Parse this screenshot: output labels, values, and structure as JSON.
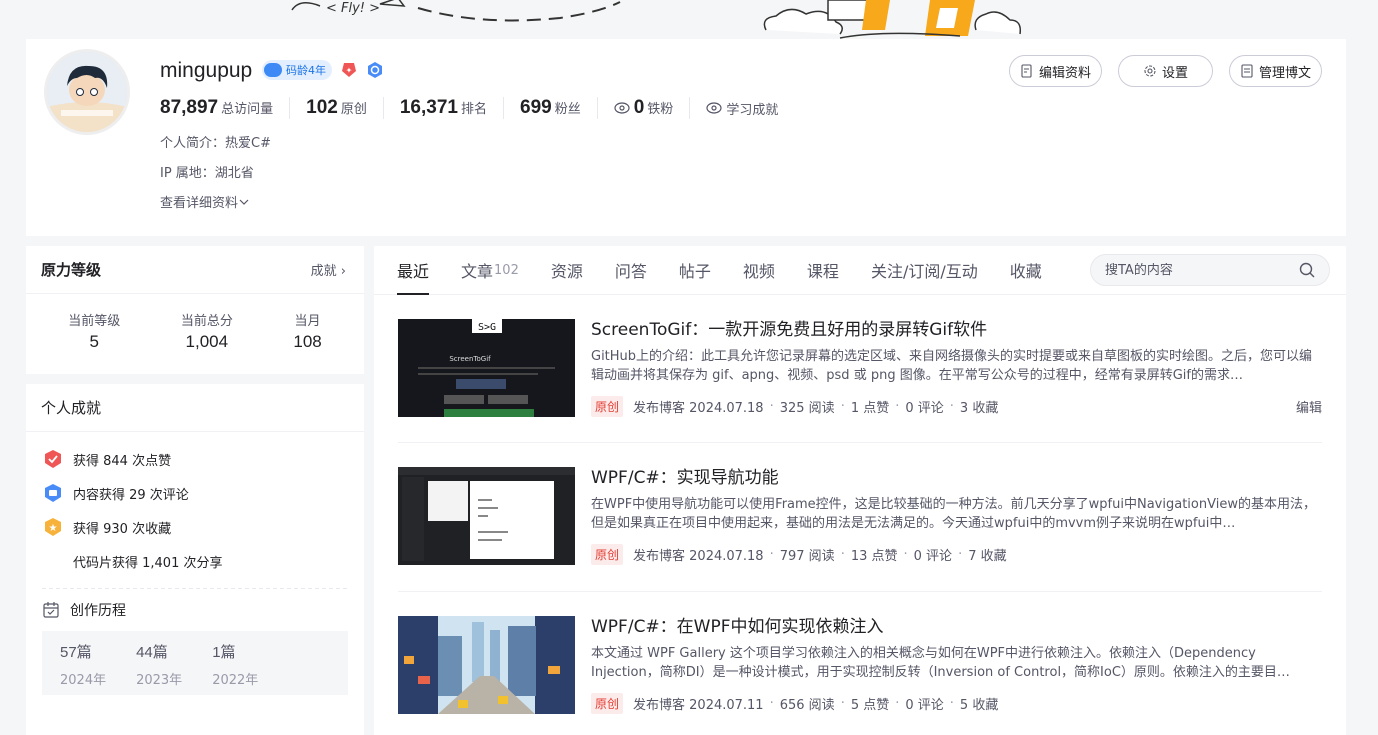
{
  "banner": {
    "fly_text": "< Fly! >"
  },
  "profile": {
    "username": "mingupup",
    "badge_age": "码龄4年",
    "stats": [
      {
        "value": "87,897",
        "label": "总访问量"
      },
      {
        "value": "102",
        "label": "原创"
      },
      {
        "value": "16,371",
        "label": "排名"
      },
      {
        "value": "699",
        "label": "粉丝"
      },
      {
        "value": "0",
        "label": "铁粉"
      }
    ],
    "learn_label": "学习成就",
    "bio": "个人简介：热爱C#",
    "ip": "IP 属地：湖北省",
    "more": "查看详细资料",
    "buttons": {
      "edit": "编辑资料",
      "settings": "设置",
      "manage": "管理博文"
    }
  },
  "level_card": {
    "title": "原力等级",
    "more": "成就",
    "items": [
      {
        "label": "当前等级",
        "value": "5"
      },
      {
        "label": "当前总分",
        "value": "1,004"
      },
      {
        "label": "当月",
        "value": "108"
      }
    ]
  },
  "achievements": {
    "title": "个人成就",
    "items": [
      {
        "text": "获得 844 次点赞",
        "icon": "like-medal-icon",
        "color": "#f05656"
      },
      {
        "text": "内容获得 29 次评论",
        "icon": "comment-medal-icon",
        "color": "#4a8cf7"
      },
      {
        "text": "获得 930 次收藏",
        "icon": "star-medal-icon",
        "color": "#f7b23b"
      },
      {
        "text": "代码片获得 1,401 次分享",
        "icon": "",
        "color": ""
      }
    ],
    "history_title": "创作历程",
    "history": [
      {
        "count": "57篇",
        "year": "2024年"
      },
      {
        "count": "44篇",
        "year": "2023年"
      },
      {
        "count": "1篇",
        "year": "2022年"
      }
    ]
  },
  "tabs": [
    {
      "label": "最近",
      "count": ""
    },
    {
      "label": "文章",
      "count": "102"
    },
    {
      "label": "资源",
      "count": ""
    },
    {
      "label": "问答",
      "count": ""
    },
    {
      "label": "帖子",
      "count": ""
    },
    {
      "label": "视频",
      "count": ""
    },
    {
      "label": "课程",
      "count": ""
    },
    {
      "label": "关注/订阅/互动",
      "count": ""
    },
    {
      "label": "收藏",
      "count": ""
    }
  ],
  "search": {
    "placeholder": "搜TA的内容"
  },
  "articles": [
    {
      "title": "ScreenToGif：一款开源免费且好用的录屏转Gif软件",
      "desc": "GitHub上的介绍：此工具允许您记录屏幕的选定区域、来自网络摄像头的实时提要或来自草图板的实时绘图。之后，您可以编辑动画并将其保存为 gif、apng、视频、psd 或 png 图像。在平常写公众号的过程中，经常有录屏转Gif的需求…",
      "tag": "原创",
      "date": "发布博客 2024.07.18",
      "reads": "325 阅读",
      "likes": "1 点赞",
      "comments": "0 评论",
      "favs": "3 收藏",
      "edit": "编辑",
      "thumb_text": "S>G",
      "thumb_caption": "ScreenToGif"
    },
    {
      "title": "WPF/C#：实现导航功能",
      "desc": "在WPF中使用导航功能可以使用Frame控件，这是比较基础的一种方法。前几天分享了wpfui中NavigationView的基本用法，但是如果真正在项目中使用起来，基础的用法是无法满足的。今天通过wpfui中的mvvm例子来说明在wpfui中…",
      "tag": "原创",
      "date": "发布博客 2024.07.18",
      "reads": "797 阅读",
      "likes": "13 点赞",
      "comments": "0 评论",
      "favs": "7 收藏",
      "edit": ""
    },
    {
      "title": "WPF/C#：在WPF中如何实现依赖注入",
      "desc": "本文通过 WPF Gallery 这个项目学习依赖注入的相关概念与如何在WPF中进行依赖注入。依赖注入（Dependency Injection，简称DI）是一种设计模式，用于实现控制反转（Inversion of Control，简称IoC）原则。依赖注入的主要目…",
      "tag": "原创",
      "date": "发布博客 2024.07.11",
      "reads": "656 阅读",
      "likes": "5 点赞",
      "comments": "0 评论",
      "favs": "5 收藏",
      "edit": ""
    }
  ]
}
